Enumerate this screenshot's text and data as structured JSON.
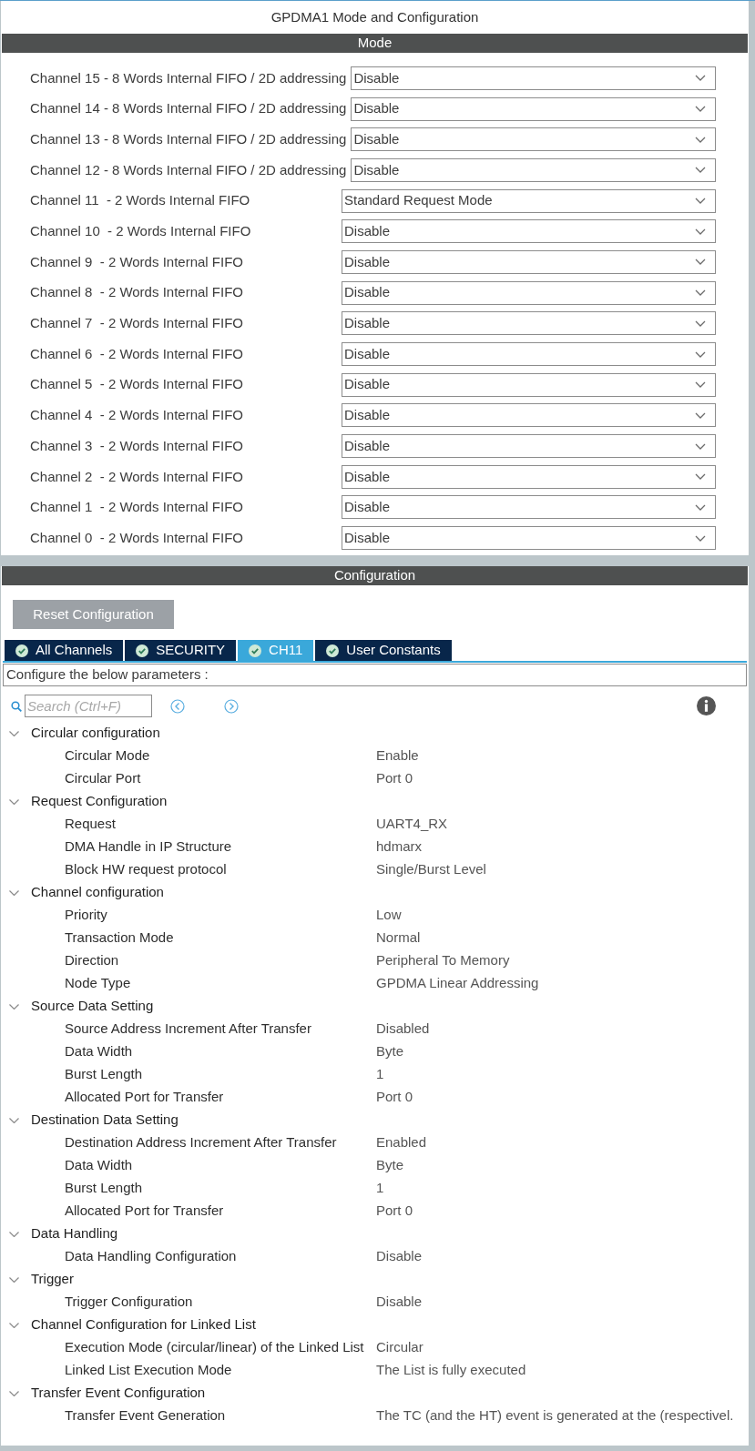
{
  "title": "GPDMA1 Mode and Configuration",
  "mode": {
    "header": "Mode",
    "channels": [
      {
        "label": "Channel 15 - 8 Words Internal FIFO / 2D addressing",
        "value": "Disable"
      },
      {
        "label": "Channel 14 - 8 Words Internal FIFO / 2D addressing",
        "value": "Disable"
      },
      {
        "label": "Channel 13 - 8 Words Internal FIFO / 2D addressing",
        "value": "Disable"
      },
      {
        "label": "Channel 12 - 8 Words Internal FIFO / 2D addressing",
        "value": "Disable"
      },
      {
        "label": "Channel 11  - 2 Words Internal FIFO",
        "value": "Standard Request Mode"
      },
      {
        "label": "Channel 10  - 2 Words Internal FIFO",
        "value": "Disable"
      },
      {
        "label": "Channel 9  - 2 Words Internal FIFO",
        "value": "Disable"
      },
      {
        "label": "Channel 8  - 2 Words Internal FIFO",
        "value": "Disable"
      },
      {
        "label": "Channel 7  - 2 Words Internal FIFO",
        "value": "Disable"
      },
      {
        "label": "Channel 6  - 2 Words Internal FIFO",
        "value": "Disable"
      },
      {
        "label": "Channel 5  - 2 Words Internal FIFO",
        "value": "Disable"
      },
      {
        "label": "Channel 4  - 2 Words Internal FIFO",
        "value": "Disable"
      },
      {
        "label": "Channel 3  - 2 Words Internal FIFO",
        "value": "Disable"
      },
      {
        "label": "Channel 2  - 2 Words Internal FIFO",
        "value": "Disable"
      },
      {
        "label": "Channel 1  - 2 Words Internal FIFO",
        "value": "Disable"
      },
      {
        "label": "Channel 0  - 2 Words Internal FIFO",
        "value": "Disable"
      }
    ]
  },
  "configuration": {
    "header": "Configuration",
    "reset_button": "Reset Configuration",
    "tabs": [
      {
        "label": "All Channels",
        "selected": false
      },
      {
        "label": "SECURITY",
        "selected": false
      },
      {
        "label": "CH11",
        "selected": true
      },
      {
        "label": "User Constants",
        "selected": false
      }
    ],
    "parameters_label": "Configure the below parameters :",
    "search": {
      "placeholder": "Search (Ctrl+F)"
    },
    "tree": [
      {
        "label": "Circular configuration",
        "expanded": true,
        "children": [
          {
            "label": "Circular Mode",
            "value": "Enable"
          },
          {
            "label": "Circular Port",
            "value": "Port 0"
          }
        ]
      },
      {
        "label": "Request Configuration",
        "expanded": true,
        "children": [
          {
            "label": "Request",
            "value": "UART4_RX"
          },
          {
            "label": "DMA Handle in IP Structure",
            "value": "hdmarx"
          },
          {
            "label": "Block HW request protocol",
            "value": "Single/Burst Level"
          }
        ]
      },
      {
        "label": "Channel configuration",
        "expanded": true,
        "children": [
          {
            "label": "Priority",
            "value": "Low"
          },
          {
            "label": "Transaction Mode",
            "value": "Normal"
          },
          {
            "label": "Direction",
            "value": "Peripheral To Memory"
          },
          {
            "label": "Node Type",
            "value": "GPDMA Linear Addressing"
          }
        ]
      },
      {
        "label": "Source Data Setting",
        "expanded": true,
        "children": [
          {
            "label": "Source Address Increment After Transfer",
            "value": "Disabled"
          },
          {
            "label": "Data Width",
            "value": "Byte"
          },
          {
            "label": "Burst Length",
            "value": "1"
          },
          {
            "label": "Allocated Port for Transfer",
            "value": "Port 0"
          }
        ]
      },
      {
        "label": "Destination Data Setting",
        "expanded": true,
        "children": [
          {
            "label": "Destination Address Increment After Transfer",
            "value": "Enabled"
          },
          {
            "label": "Data Width",
            "value": "Byte"
          },
          {
            "label": "Burst Length",
            "value": "1"
          },
          {
            "label": "Allocated Port for Transfer",
            "value": "Port 0"
          }
        ]
      },
      {
        "label": "Data Handling",
        "expanded": true,
        "children": [
          {
            "label": "Data Handling Configuration",
            "value": "Disable"
          }
        ]
      },
      {
        "label": "Trigger",
        "expanded": true,
        "children": [
          {
            "label": "Trigger Configuration",
            "value": "Disable"
          }
        ]
      },
      {
        "label": "Channel Configuration for Linked List",
        "expanded": true,
        "children": [
          {
            "label": "Execution Mode (circular/linear) of the Linked List",
            "value": "Circular"
          },
          {
            "label": "Linked List Execution Mode",
            "value": "The List is fully executed"
          }
        ]
      },
      {
        "label": "Transfer Event Configuration",
        "expanded": true,
        "children": [
          {
            "label": "Transfer Event Generation",
            "value": "The TC (and the HT) event is generated at the (respectivel."
          }
        ]
      }
    ]
  }
}
